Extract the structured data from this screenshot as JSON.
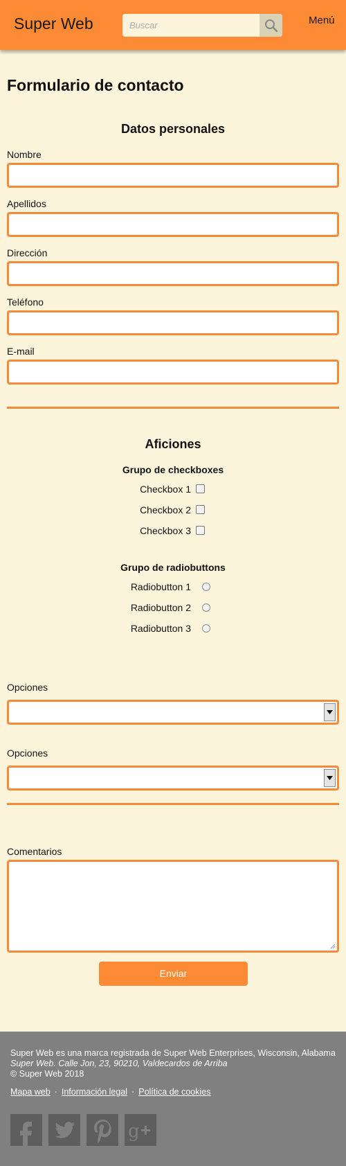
{
  "header": {
    "brand": "Super Web",
    "search_placeholder": "Buscar",
    "menu_label": "Menú"
  },
  "page_title": "Formulario de contacto",
  "personal": {
    "title": "Datos personales",
    "fields": [
      "Nombre",
      "Apellidos",
      "Dirección",
      "Teléfono",
      "E-mail"
    ]
  },
  "hobbies": {
    "title": "Aficiones",
    "checkbox_group": {
      "title": "Grupo de checkboxes",
      "items": [
        "Checkbox 1",
        "Checkbox 2",
        "Checkbox 3"
      ]
    },
    "radio_group": {
      "title": "Grupo de radiobuttons",
      "items": [
        "Radiobutton 1",
        "Radiobutton 2",
        "Radiobutton 3"
      ]
    }
  },
  "options": {
    "label1": "Opciones",
    "label2": "Opciones"
  },
  "comments_label": "Comentarios",
  "submit_label": "Enviar",
  "footer": {
    "line1": "Super Web es una marca registrada de Super Web Enterprises, Wisconsin, Alabama",
    "line2": "Super Web. Calle Jon, 23, 90210, Valdecardos de Arriba",
    "line3": "© Super Web 2018",
    "links": [
      "Mapa web",
      "Información legal",
      "Política de cookies"
    ],
    "social_icons": [
      "facebook-icon",
      "twitter-icon",
      "pinterest-icon",
      "google-plus-icon"
    ]
  },
  "colors": {
    "accent": "#fd8a34",
    "background": "#fcf5dc",
    "footer": "#808080"
  }
}
